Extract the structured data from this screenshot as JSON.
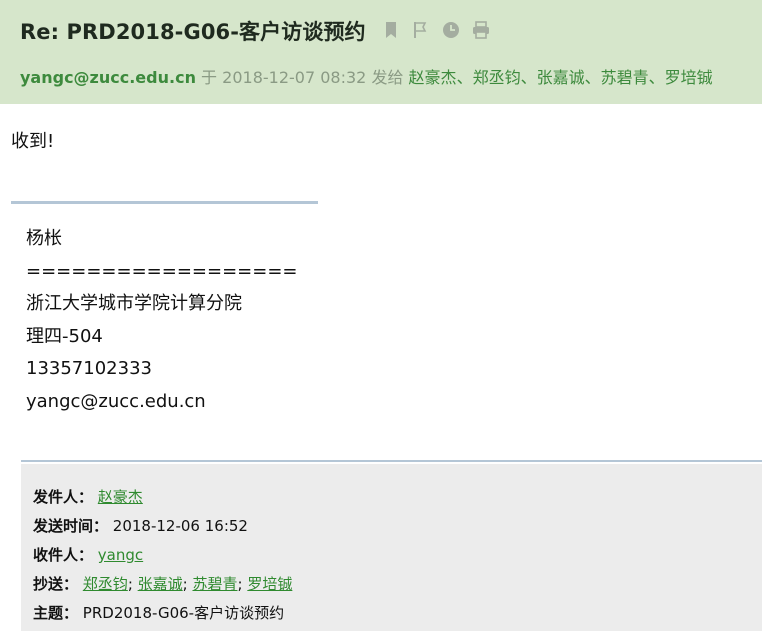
{
  "email": {
    "subject": "Re: PRD2018-G06-客户访谈预约",
    "sender": "yangc@zucc.edu.cn",
    "on_word": "于",
    "date": "2018-12-07 08:32",
    "sent_to_word": "发给",
    "recipients": [
      "赵豪杰",
      "郑丞钧",
      "张嘉诚",
      "苏碧青",
      "罗培铖"
    ],
    "separator": "、",
    "body": "收到!"
  },
  "toolbar": {
    "icons": [
      "bookmark-icon",
      "flag-icon",
      "clock-icon",
      "print-icon"
    ]
  },
  "signature": {
    "name": "杨枨",
    "rule": "==================",
    "org": "浙江大学城市学院计算分院",
    "room": "理四-504",
    "phone": "13357102333",
    "email": "yangc@zucc.edu.cn"
  },
  "quoted": {
    "from_label": "发件人：",
    "from": "赵豪杰",
    "sent_label": "发送时间：",
    "sent": "2018-12-06 16:52",
    "to_label": "收件人：",
    "to": "yangc",
    "cc_label": "抄送：",
    "cc": [
      "郑丞钧",
      "张嘉诚",
      "苏碧青",
      "罗培铖"
    ],
    "cc_sep": ";",
    "subject_label": "主题：",
    "subject": "PRD2018-G06-客户访谈预约"
  },
  "colors": {
    "header_bg": "#d6e6cb",
    "link": "#2f8a2f",
    "divider": "#b4c6d6",
    "quote_bg": "#ececec"
  }
}
